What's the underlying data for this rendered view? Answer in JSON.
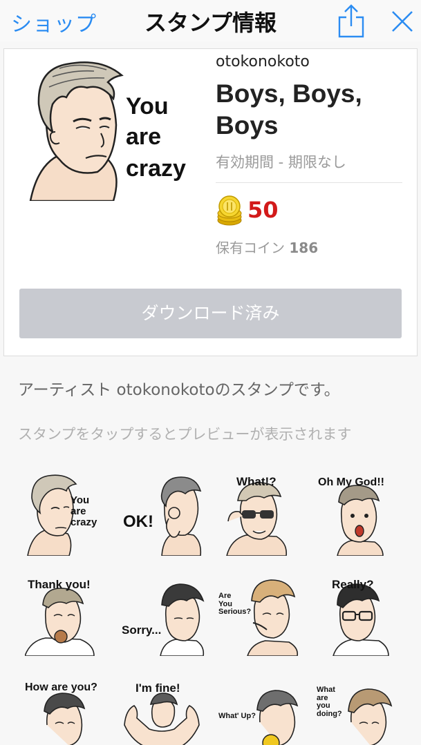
{
  "nav": {
    "back_label": "ショップ",
    "title": "スタンプ情報",
    "share_icon": "share-icon",
    "close_icon": "close-icon"
  },
  "header": {
    "main_sticker_lines": [
      "You",
      "are",
      "crazy"
    ],
    "author": "otokonokoto",
    "title": "Boys, Boys, Boys",
    "validity": "有効期間 - 期限なし",
    "price": "50",
    "owned_label": "保有コイン",
    "owned_count": "186",
    "download_label": "ダウンロード済み"
  },
  "description": "アーティスト otokonokotoのスタンプです。",
  "hint": "スタンプをタップするとプレビューが表示されます",
  "stickers": [
    {
      "text": "You\nare\ncrazy"
    },
    {
      "text": "OK!"
    },
    {
      "text": "What!?"
    },
    {
      "text": "Oh My God!!"
    },
    {
      "text": "Thank you!"
    },
    {
      "text": "Sorry..."
    },
    {
      "text": "Are\nYou\nSerious?"
    },
    {
      "text": "Really?"
    },
    {
      "text": "How are you?"
    },
    {
      "text": "I'm fine!"
    },
    {
      "text": "What' Up?"
    },
    {
      "text": "What\nare\nyou\ndoing?"
    }
  ],
  "colors": {
    "accent": "#2b8cf2",
    "price": "#d21a1a",
    "button_disabled": "#c8cad0"
  }
}
